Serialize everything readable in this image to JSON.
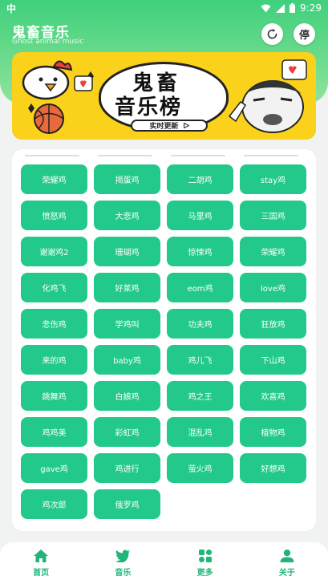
{
  "status_bar": {
    "left_icon": "app-notification-icon",
    "left_text": "中",
    "time": "9:29"
  },
  "header": {
    "title": "鬼畜音乐",
    "subtitle": "Ghost animal music",
    "refresh_icon": "refresh-icon",
    "stop_label": "停"
  },
  "banner": {
    "line1": "鬼畜",
    "line2": "音乐榜",
    "pill_text": "实时更新",
    "pill_icon": "play-triangle-icon"
  },
  "songs": [
    "荣耀鸡",
    "揭蛋鸡",
    "二胡鸡",
    "stay鸡",
    "愤怒鸡",
    "大悲鸡",
    "马里鸡",
    "三国鸡",
    "谢谢鸡2",
    "珊瑚鸡",
    "惊悚鸡",
    "荣耀鸡",
    "化鸡飞",
    "好莱鸡",
    "eom鸡",
    "love鸡",
    "悲伤鸡",
    "学鸡叫",
    "功夫鸡",
    "狂放鸡",
    "来的鸡",
    "baby鸡",
    "鸡儿飞",
    "下山鸡",
    "跳舞鸡",
    "白娘鸡",
    "鸡之王",
    "欢喜鸡",
    "鸡鸡美",
    "彩虹鸡",
    "混乱鸡",
    "植物鸡",
    "gave鸡",
    "鸡进行",
    "萤火鸡",
    "好想鸡",
    "鸡次郎",
    "俄罗鸡"
  ],
  "nav": {
    "home": "首页",
    "music": "音乐",
    "more": "更多",
    "about": "关于"
  },
  "colors": {
    "accent": "#22c98a",
    "header_green": "#3fd07d",
    "nav_green": "#21b679",
    "banner_yellow": "#fbd21b"
  }
}
